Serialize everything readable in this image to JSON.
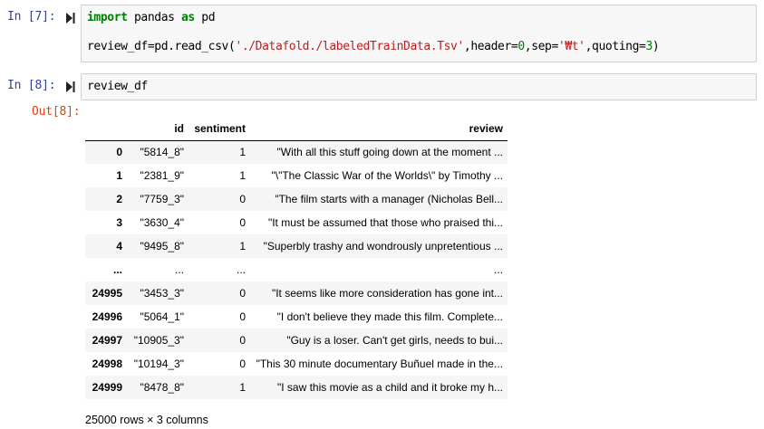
{
  "cells": [
    {
      "prompt": "In [7]:",
      "code": {
        "line1": {
          "kw1": "import",
          "mid": " pandas ",
          "kw2": "as",
          "end": " pd"
        },
        "line2": {
          "pre": "review_df=pd.read_csv(",
          "str1": "'./Datafold./labeledTrainData.Tsv'",
          "mid1": ",header=",
          "num1": "0",
          "mid2": ",sep=",
          "str2": "'₩t'",
          "mid3": ",quoting=",
          "num2": "3",
          "end": ")"
        }
      }
    },
    {
      "prompt": "In [8]:",
      "code": {
        "line1": "review_df"
      },
      "out_prompt": "Out[8]:"
    }
  ],
  "output": {
    "columns": [
      "",
      "id",
      "sentiment",
      "review"
    ],
    "rows": [
      {
        "index": "0",
        "id": "\"5814_8\"",
        "sentiment": "1",
        "review": "\"With all this stuff going down at the moment ..."
      },
      {
        "index": "1",
        "id": "\"2381_9\"",
        "sentiment": "1",
        "review": "\"\\\"The Classic War of the Worlds\\\" by Timothy ..."
      },
      {
        "index": "2",
        "id": "\"7759_3\"",
        "sentiment": "0",
        "review": "\"The film starts with a manager (Nicholas Bell..."
      },
      {
        "index": "3",
        "id": "\"3630_4\"",
        "sentiment": "0",
        "review": "\"It must be assumed that those who praised thi..."
      },
      {
        "index": "4",
        "id": "\"9495_8\"",
        "sentiment": "1",
        "review": "\"Superbly trashy and wondrously unpretentious ..."
      },
      {
        "index": "...",
        "id": "...",
        "sentiment": "...",
        "review": "..."
      },
      {
        "index": "24995",
        "id": "\"3453_3\"",
        "sentiment": "0",
        "review": "\"It seems like more consideration has gone int..."
      },
      {
        "index": "24996",
        "id": "\"5064_1\"",
        "sentiment": "0",
        "review": "\"I don't believe they made this film. Complete..."
      },
      {
        "index": "24997",
        "id": "\"10905_3\"",
        "sentiment": "0",
        "review": "\"Guy is a loser. Can't get girls, needs to bui..."
      },
      {
        "index": "24998",
        "id": "\"10194_3\"",
        "sentiment": "0",
        "review": "\"This 30 minute documentary Buñuel made in the..."
      },
      {
        "index": "24999",
        "id": "\"8478_8\"",
        "sentiment": "1",
        "review": "\"I saw this movie as a child and it broke my h..."
      }
    ],
    "shape": "25000 rows × 3 columns"
  },
  "icons": {
    "run": "run-cell-icon"
  },
  "colors": {
    "in_prompt": "#303f9f",
    "out_prompt": "#d84315",
    "keyword": "#008000",
    "string": "#ba2121"
  }
}
